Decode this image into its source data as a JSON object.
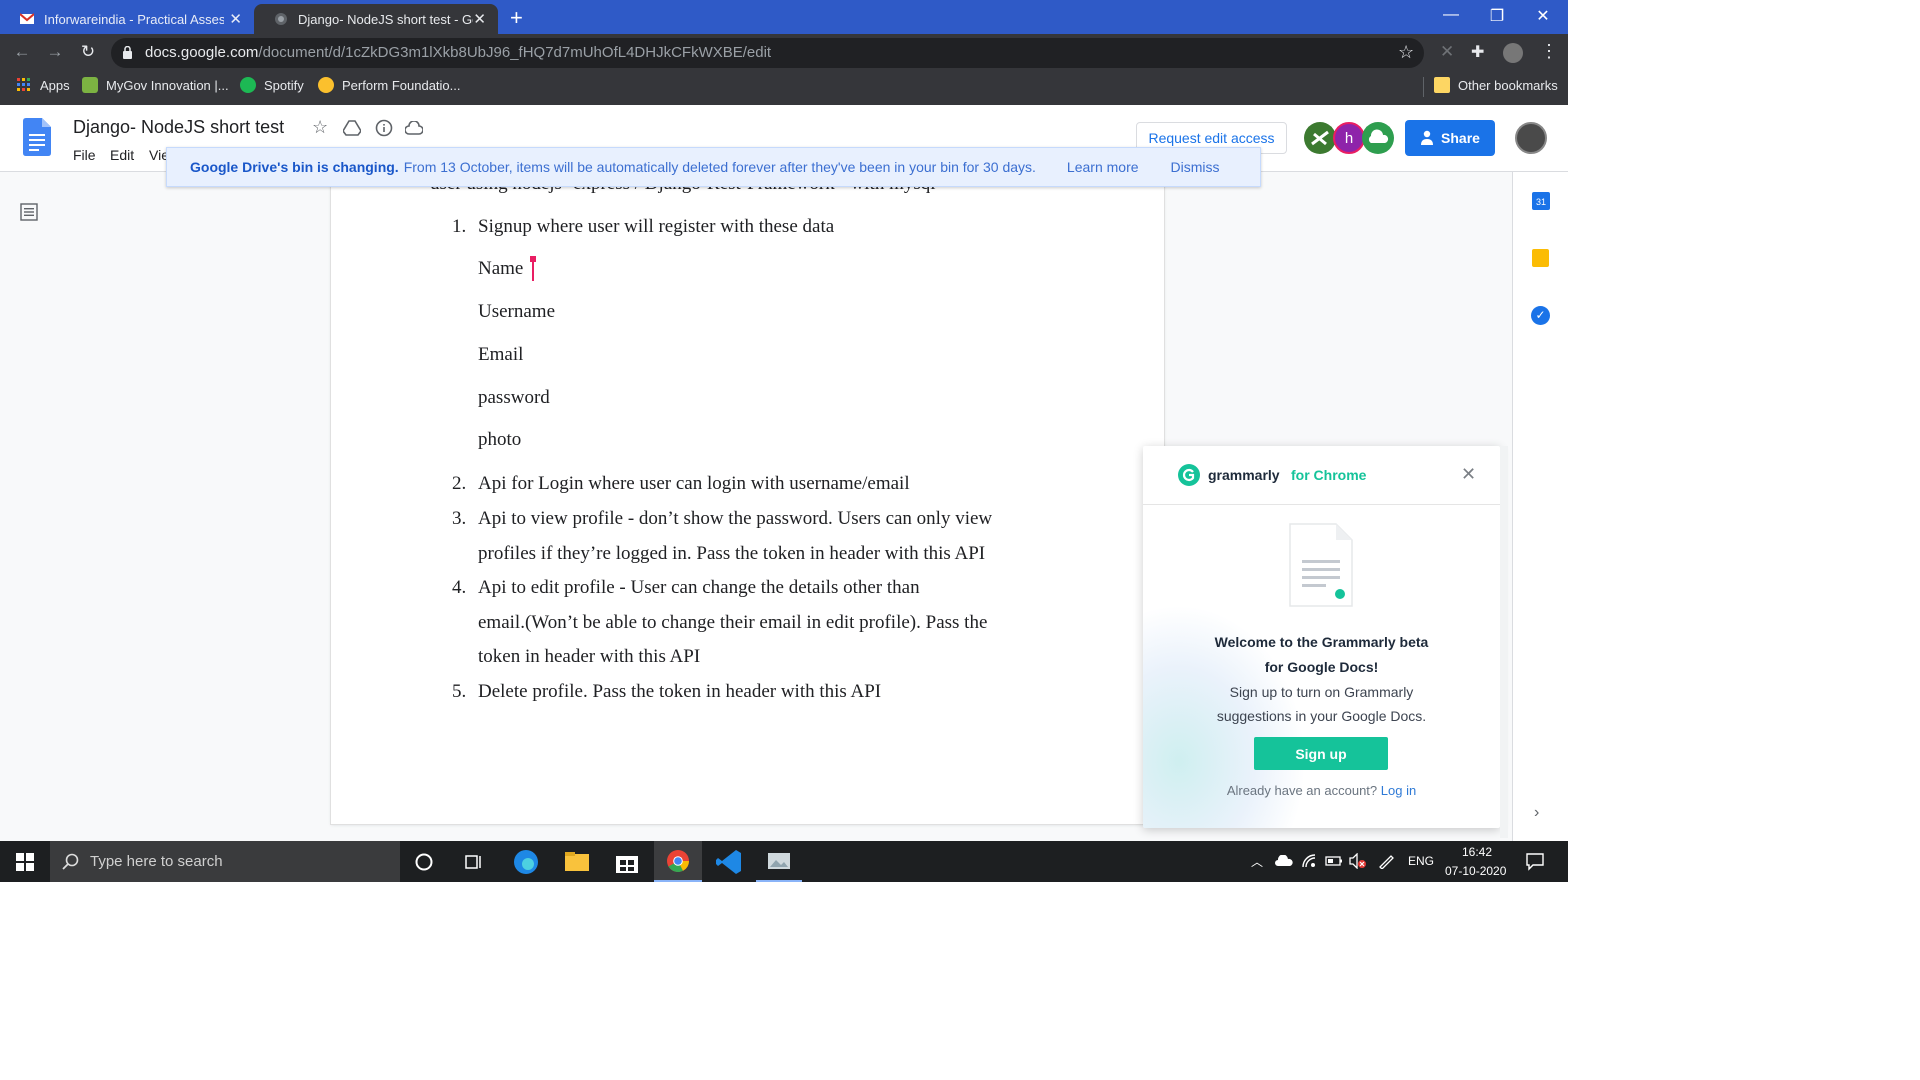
{
  "browser": {
    "tabs": [
      {
        "title": "Inforwareindia - Practical Assessm",
        "active": false
      },
      {
        "title": "Django- NodeJS short test - Goo",
        "active": true
      }
    ],
    "new_tab": "+",
    "url_host": "docs.google.com",
    "url_path": "/document/d/1cZkDG3m1lXkb8UbJ96_fHQ7d7mUhOfL4DHJkCFkWXBE/edit",
    "bookmarks": [
      "Apps",
      "MyGov Innovation |...",
      "Spotify",
      "Perform Foundatio..."
    ],
    "other_bookmarks": "Other bookmarks"
  },
  "docs": {
    "title": "Django- NodeJS short test",
    "menus": [
      "File",
      "Edit",
      "Vie"
    ],
    "request_edit": "Request edit access",
    "share": "Share",
    "avatar_letter": "h"
  },
  "banner": {
    "strong": "Google Drive's bin is changing.",
    "text": "From 13 October, items will be automatically deleted forever after they've been in your bin for 30 days.",
    "learn_more": "Learn more",
    "dismiss": "Dismiss"
  },
  "document": {
    "cut_line": "user using nodejs- express / Django-Rest-Framework - with mysql",
    "items": [
      {
        "num": "1.",
        "lines": [
          "Signup where user will register with these data"
        ]
      },
      {
        "num": "2.",
        "lines": [
          "Api for Login where user can login with username/email"
        ]
      },
      {
        "num": "3.",
        "lines": [
          "Api to view profile - don’t show the password. Users can only view",
          "profiles if they’re logged in. Pass the token in header with this API"
        ]
      },
      {
        "num": "4.",
        "lines": [
          "Api to edit profile - User can  change the details other than",
          "email.(Won’t be able to change their email in edit profile). Pass the",
          "token in header with this API"
        ]
      },
      {
        "num": "5.",
        "lines": [
          "Delete profile. Pass the token in header with this API"
        ]
      }
    ],
    "fields": [
      "Name",
      "Username",
      "Email",
      "password",
      "photo"
    ]
  },
  "grammarly": {
    "brand": "grammarly",
    "for_chrome": "for Chrome",
    "welcome_1": "Welcome to the Grammarly beta",
    "welcome_2": "for Google Docs!",
    "body_1": "Sign up to turn on Grammarly",
    "body_2": "suggestions in your Google Docs.",
    "signup": "Sign up",
    "have_account": "Already have an account?",
    "login": "Log in"
  },
  "taskbar": {
    "search_placeholder": "Type here to search",
    "lang": "ENG",
    "time": "16:42",
    "date": "07-10-2020"
  },
  "colors": {
    "chrome_tabstrip": "#2f5ac7",
    "docs_blue": "#1a73e8",
    "grammarly_green": "#15c39a"
  }
}
